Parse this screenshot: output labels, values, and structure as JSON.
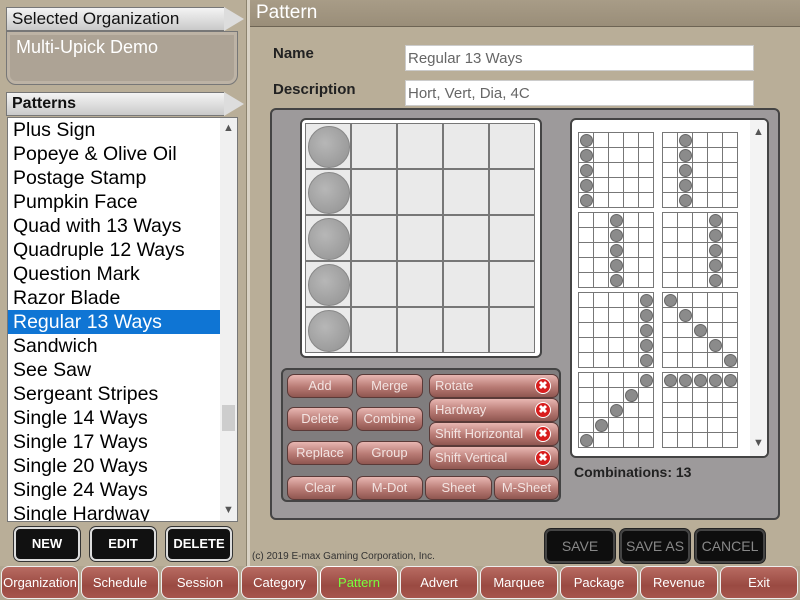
{
  "sidebar": {
    "org_header": "Selected Organization",
    "org_name": "Multi-Upick Demo",
    "patterns_header": "Patterns",
    "patterns": [
      "Plus Sign",
      "Popeye & Olive Oil",
      "Postage Stamp",
      "Pumpkin Face",
      "Quad with 13 Ways",
      "Quadruple 12 Ways",
      "Question Mark",
      "Razor Blade",
      "Regular 13 Ways",
      "Sandwich",
      "See Saw",
      "Sergeant Stripes",
      "Single 14 Ways",
      "Single 17 Ways",
      "Single 20 Ways",
      "Single 24 Ways",
      "Single Hardway"
    ],
    "selected_index": 8,
    "buttons": {
      "new": "NEW",
      "edit": "EDIT",
      "delete": "DELETE"
    }
  },
  "main": {
    "title": "Pattern",
    "name_label": "Name",
    "name_value": "Regular 13 Ways",
    "description_label": "Description",
    "description_value": "Hort, Vert, Dia, 4C",
    "grid_filled": [
      [
        0,
        0
      ],
      [
        1,
        0
      ],
      [
        2,
        0
      ],
      [
        3,
        0
      ],
      [
        4,
        0
      ]
    ],
    "actions": {
      "add": "Add",
      "merge": "Merge",
      "rotate": "Rotate",
      "delete": "Delete",
      "combine": "Combine",
      "hardway": "Hardway",
      "replace": "Replace",
      "group": "Group",
      "shift_horizontal": "Shift Horizontal",
      "shift_vertical": "Shift Vertical",
      "clear": "Clear",
      "m_dot": "M-Dot",
      "sheet": "Sheet",
      "m_sheet": "M-Sheet",
      "close_glyph": "✖"
    },
    "combinations_label": "Combinations: 13",
    "combination_thumbs": [
      [
        [
          0,
          0
        ],
        [
          1,
          0
        ],
        [
          2,
          0
        ],
        [
          3,
          0
        ],
        [
          4,
          0
        ]
      ],
      [
        [
          0,
          1
        ],
        [
          1,
          1
        ],
        [
          2,
          1
        ],
        [
          3,
          1
        ],
        [
          4,
          1
        ]
      ],
      [
        [
          0,
          2
        ],
        [
          1,
          2
        ],
        [
          2,
          2
        ],
        [
          3,
          2
        ],
        [
          4,
          2
        ]
      ],
      [
        [
          0,
          3
        ],
        [
          1,
          3
        ],
        [
          2,
          3
        ],
        [
          3,
          3
        ],
        [
          4,
          3
        ]
      ],
      [
        [
          0,
          4
        ],
        [
          1,
          4
        ],
        [
          2,
          4
        ],
        [
          3,
          4
        ],
        [
          4,
          4
        ]
      ],
      [
        [
          0,
          0
        ],
        [
          1,
          1
        ],
        [
          2,
          2
        ],
        [
          3,
          3
        ],
        [
          4,
          4
        ]
      ],
      [
        [
          0,
          4
        ],
        [
          1,
          3
        ],
        [
          2,
          2
        ],
        [
          3,
          1
        ],
        [
          4,
          0
        ]
      ],
      [
        [
          0,
          0
        ],
        [
          0,
          1
        ],
        [
          0,
          2
        ],
        [
          0,
          3
        ],
        [
          0,
          4
        ]
      ]
    ],
    "footer_buttons": {
      "save": "SAVE",
      "save_as": "SAVE AS",
      "cancel": "CANCEL"
    },
    "copyright": "(c) 2019 E-max Gaming Corporation, Inc."
  },
  "nav": {
    "tabs": [
      "Organization",
      "Schedule",
      "Session",
      "Category",
      "Pattern",
      "Advert",
      "Marquee",
      "Package",
      "Revenue",
      "Exit"
    ],
    "active_index": 4
  },
  "icons": {
    "scroll_up": "▲",
    "scroll_down": "▼"
  },
  "colors": {
    "selection": "#0f75d4",
    "active_tab_text": "#78ff3c",
    "tab_bg": "#a7554d",
    "close_icon": "#d81e1e"
  }
}
